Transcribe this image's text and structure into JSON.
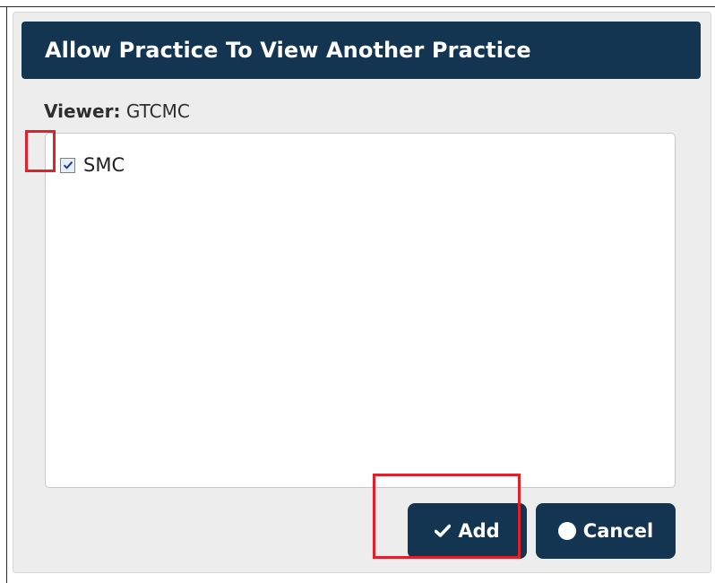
{
  "dialog": {
    "title": "Allow Practice To View Another Practice",
    "viewer_label": "Viewer:",
    "viewer_value": "GTCMC"
  },
  "practice_list": {
    "items": [
      {
        "label": "SMC",
        "checked": true
      }
    ]
  },
  "buttons": {
    "add_label": "Add",
    "add_icon": "checkmark-icon",
    "cancel_label": "Cancel",
    "cancel_icon": "circle-icon"
  },
  "colors": {
    "header_bg": "#133552",
    "button_bg": "#133552",
    "dialog_bg": "#ededed",
    "highlight": "#e0202b"
  }
}
